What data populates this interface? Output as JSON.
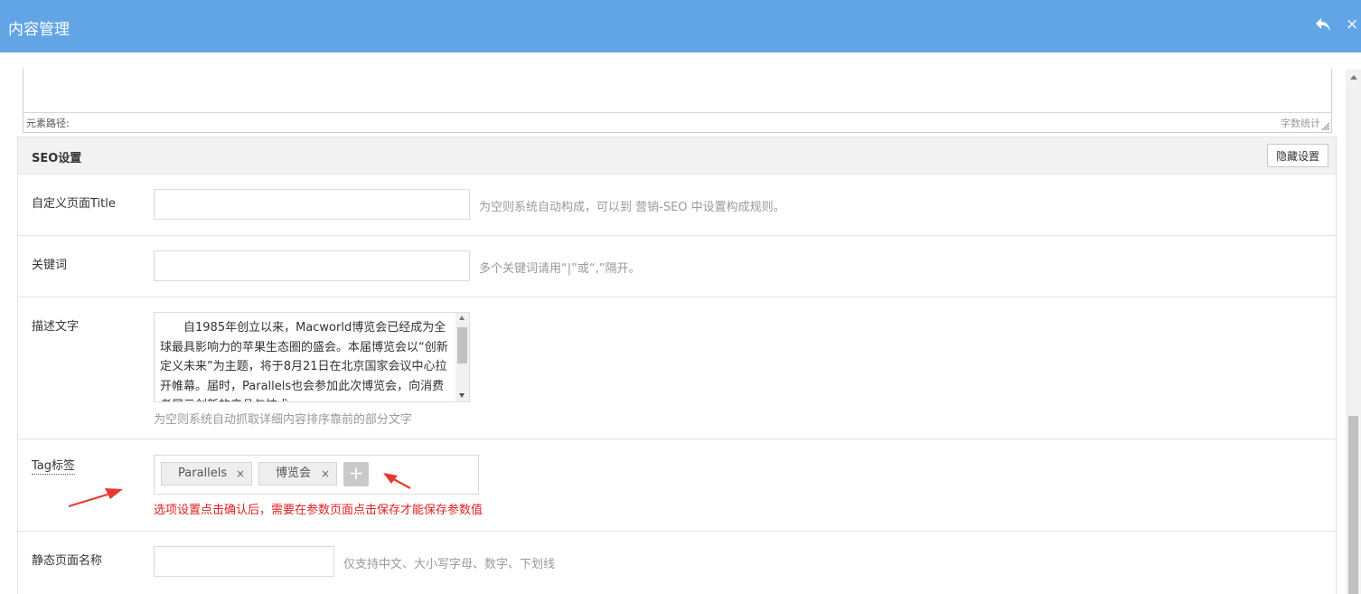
{
  "window": {
    "title": "内容管理",
    "back_icon": "back-arrow-icon",
    "close_icon": "close-icon",
    "close_glyph": "×"
  },
  "editor": {
    "path_label": "元素路径:",
    "count_label": "字数统计"
  },
  "seo": {
    "title": "SEO设置",
    "hide_button": "隐藏设置",
    "fields": {
      "page_title": {
        "label": "自定义页面Title",
        "value": "",
        "hint": "为空则系统自动构成，可以到 营销-SEO 中设置构成规则。"
      },
      "keywords": {
        "label": "关键词",
        "value": "",
        "hint": "多个关键词请用“|”或“,”隔开。"
      },
      "description": {
        "label": "描述文字",
        "value": "　　自1985年创立以来，Macworld博览会已经成为全球最具影响力的苹果生态圈的盛会。本届博览会以“创新定义未来”为主题，将于8月21日在北京国家会议中心拉开帷幕。届时，Parallels也会参加此次博览会，向消费者展示创新的产品与技术。",
        "hint": "为空则系统自动抓取详细内容排序靠前的部分文字"
      },
      "tags": {
        "label": "Tag标签",
        "items": [
          {
            "text": "Parallels",
            "remove": "×"
          },
          {
            "text": "博览会",
            "remove": "×"
          }
        ],
        "add_glyph": "+",
        "note": "选项设置点击确认后，需要在参数页面点击保存才能保存参数值"
      },
      "static_name": {
        "label": "静态页面名称",
        "value": "",
        "hint": "仅支持中文、大小写字母、数字、下划线"
      }
    }
  },
  "annotations": {
    "arrow_color": "#e8392f"
  },
  "colors": {
    "header": "#61a5e6",
    "note": "#e02020"
  }
}
